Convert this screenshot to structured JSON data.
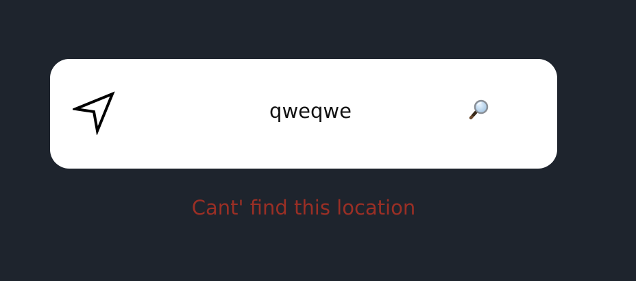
{
  "search": {
    "value": "qweqwe",
    "location_icon": "navigation-arrow-icon",
    "search_icon": "magnifier-icon"
  },
  "error": {
    "message": "Cant' find this location"
  },
  "colors": {
    "background": "#1e242d",
    "card": "#ffffff",
    "error": "#9a2f25",
    "text": "#111111"
  }
}
